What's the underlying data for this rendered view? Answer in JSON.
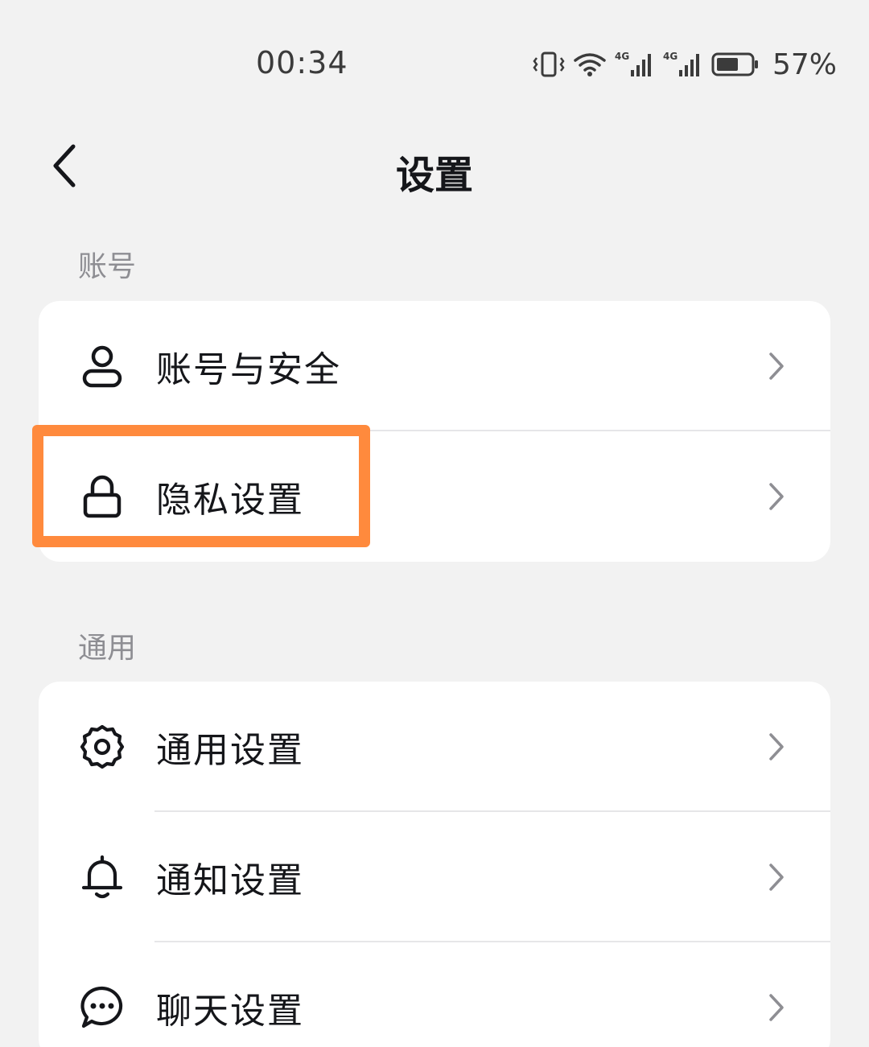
{
  "status_bar": {
    "time": "00:34",
    "battery": "57%",
    "icons": [
      "vibrate-icon",
      "wifi-icon",
      "signal-4g-icon",
      "signal-4g-icon",
      "battery-icon"
    ]
  },
  "header": {
    "title": "设置",
    "back_icon": "chevron-left-icon"
  },
  "sections": [
    {
      "label": "账号",
      "items": [
        {
          "label": "账号与安全",
          "icon": "user-icon"
        },
        {
          "label": "隐私设置",
          "icon": "lock-icon"
        }
      ]
    },
    {
      "label": "通用",
      "items": [
        {
          "label": "通用设置",
          "icon": "gear-icon"
        },
        {
          "label": "通知设置",
          "icon": "bell-icon"
        },
        {
          "label": "聊天设置",
          "icon": "chat-bubble-icon"
        }
      ]
    }
  ],
  "colors": {
    "background": "#f2f2f2",
    "card": "#ffffff",
    "text_primary": "#15161a",
    "text_secondary": "#8e8e93",
    "highlight": "#ff8a3d"
  }
}
